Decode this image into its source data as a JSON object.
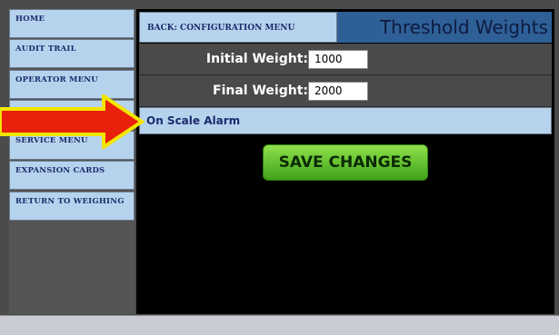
{
  "sidebar": {
    "items": [
      {
        "label": "HOME"
      },
      {
        "label": "AUDIT TRAIL"
      },
      {
        "label": "OPERATOR MENU"
      },
      {
        "label": ""
      },
      {
        "label": "SERVICE MENU"
      },
      {
        "label": "EXPANSION CARDS"
      },
      {
        "label": "RETURN TO WEIGHING"
      }
    ]
  },
  "header": {
    "back_label": "BACK: CONFIGURATION MENU",
    "title": "Threshold Weights"
  },
  "fields": {
    "initial_weight_label": "Initial Weight:",
    "initial_weight_value": "1000",
    "final_weight_label": "Final Weight:",
    "final_weight_value": "2000"
  },
  "alarm": {
    "label": "On Scale Alarm"
  },
  "actions": {
    "save_label": "SAVE CHANGES"
  },
  "colors": {
    "nav_bg": "#b6d3ee",
    "title_bg": "#2f5f97",
    "save_green": "#3ea31a",
    "arrow_red": "#e8200c",
    "arrow_yellow": "#f2e600"
  }
}
